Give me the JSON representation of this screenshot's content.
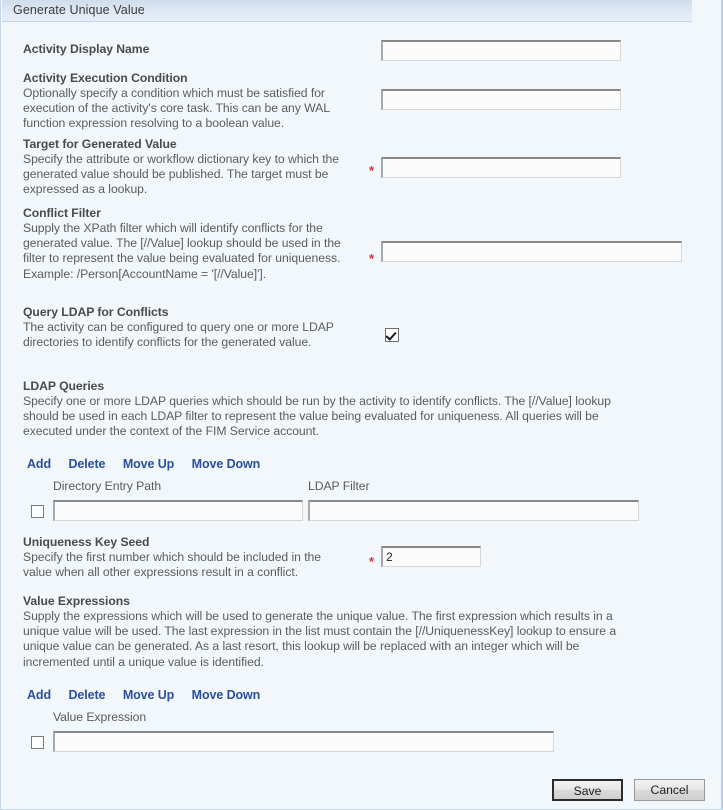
{
  "window": {
    "title": "Generate Unique Value"
  },
  "fields": {
    "activity_display_name": {
      "label": "Activity Display Name",
      "value": "",
      "required": false
    },
    "activity_execution_condition": {
      "label": "Activity Execution Condition",
      "description": "Optionally specify a condition which must be satisfied for execution of the activity's core task. This can be any WAL function expression resolving to a boolean value.",
      "value": "",
      "required": false
    },
    "target_for_generated_value": {
      "label": "Target for Generated Value",
      "description": "Specify the attribute or workflow dictionary key to which the generated value should be published. The target must be expressed as a lookup.",
      "value": "",
      "required": true,
      "required_marker": "*"
    },
    "conflict_filter": {
      "label": "Conflict Filter",
      "description": "Supply the XPath filter which will identify conflicts for the generated value. The [//Value] lookup should be used in the filter to represent the value being evaluated for uniqueness. Example: /Person[AccountName = '[//Value]'].",
      "value": "",
      "required": true,
      "required_marker": "*"
    },
    "query_ldap_for_conflicts": {
      "label": "Query LDAP for Conflicts",
      "description": "The activity can be configured to query one or more LDAP directories to identify conflicts for the generated value.",
      "checked": true
    },
    "uniqueness_key_seed": {
      "label": "Uniqueness Key Seed",
      "description": "Specify the first number which should be included in the value when all other expressions result in a conflict.",
      "value": "2",
      "required": true,
      "required_marker": "*"
    }
  },
  "ldap_queries": {
    "label": "LDAP Queries",
    "description": "Specify one or more LDAP queries which should be run by the activity to identify conflicts. The [//Value] lookup should be used in each LDAP filter to represent the value being evaluated for uniqueness. All queries will be executed under the context of the FIM Service account.",
    "toolbar": {
      "add": "Add",
      "delete": "Delete",
      "move_up": "Move Up",
      "move_down": "Move Down"
    },
    "columns": {
      "directory_entry_path": "Directory Entry Path",
      "ldap_filter": "LDAP Filter"
    },
    "rows": [
      {
        "selected": false,
        "directory_entry_path": "",
        "ldap_filter": ""
      }
    ]
  },
  "value_expressions": {
    "label": "Value Expressions",
    "description": "Supply the expressions which will be used to generate the unique value. The first expression which results in a unique value will be used. The last expression in the list must contain the [//UniquenessKey] lookup to ensure a unique value can be generated. As a last resort, this lookup will be replaced with an integer which will be incremented until a unique value is identified.",
    "toolbar": {
      "add": "Add",
      "delete": "Delete",
      "move_up": "Move Up",
      "move_down": "Move Down"
    },
    "columns": {
      "value_expression": "Value Expression"
    },
    "rows": [
      {
        "selected": false,
        "value_expression": ""
      }
    ]
  },
  "footer": {
    "save_label": "Save",
    "cancel_label": "Cancel"
  },
  "colors": {
    "background": "#f2f7fb",
    "titlebar_start": "#cfdcea",
    "titlebar_end": "#e7eefa",
    "link": "#2a4f9c",
    "required": "#d1332e",
    "label_text": "#4a4a4a"
  }
}
